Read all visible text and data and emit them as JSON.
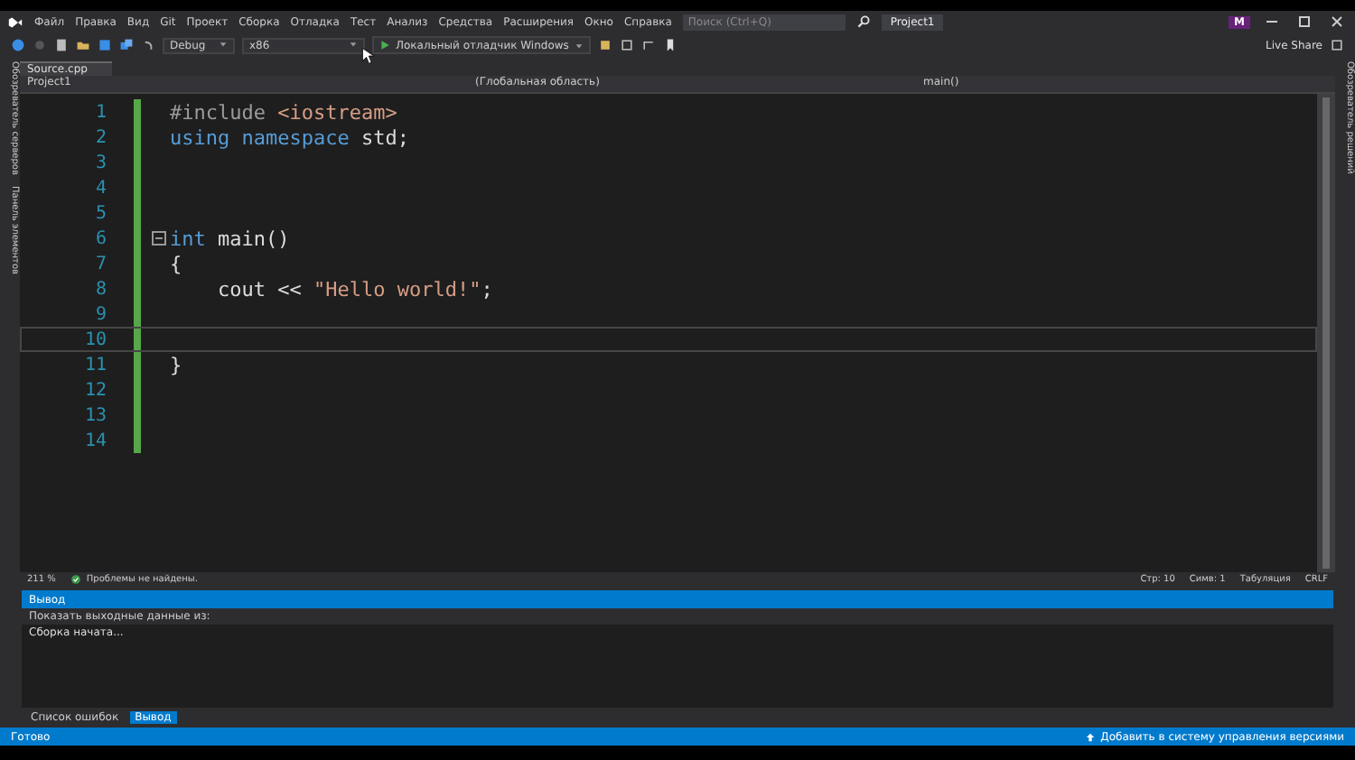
{
  "menu": [
    "Файл",
    "Правка",
    "Вид",
    "Git",
    "Проект",
    "Сборка",
    "Отладка",
    "Тест",
    "Анализ",
    "Средства",
    "Расширения",
    "Окно",
    "Справка"
  ],
  "search": {
    "placeholder": "Поиск (Ctrl+Q)"
  },
  "window": {
    "title": "Project1",
    "avatar": "M"
  },
  "toolbar": {
    "configuration": "Debug",
    "platform": "x86",
    "debugger": "Локальный отладчик Windows",
    "live_share": "Live Share"
  },
  "side_left": [
    "Обозреватель серверов",
    "Панель элементов"
  ],
  "side_right": [
    "Обозреватель решений"
  ],
  "tabs": [
    {
      "label": "Source.cpp",
      "selected": true
    }
  ],
  "nav": {
    "project": "Project1",
    "scope": "(Глобальная область)",
    "member": "main()"
  },
  "code": [
    {
      "number": "1",
      "tokens": [
        {
          "kind": "pre",
          "text": "#include"
        },
        {
          "kind": "inc",
          "text": " <iostream>"
        }
      ]
    },
    {
      "number": "2",
      "tokens": [
        {
          "kind": "keyword",
          "text": "using"
        },
        {
          "kind": "keyword",
          "text": " namespace"
        },
        {
          "kind": "plain",
          "text": " std;"
        }
      ]
    },
    {
      "number": "3"
    },
    {
      "number": "4"
    },
    {
      "number": "5"
    },
    {
      "number": "6",
      "fold": true,
      "tokens": [
        {
          "kind": "keyword",
          "text": "int"
        },
        {
          "kind": "plain",
          "text": " main()"
        }
      ]
    },
    {
      "number": "7",
      "tokens": [
        {
          "kind": "plain",
          "text": "{"
        }
      ]
    },
    {
      "number": "8",
      "tokens": [
        {
          "kind": "plain",
          "text": "    cout << "
        },
        {
          "kind": "string",
          "text": "\"Hello world!\""
        },
        {
          "kind": "plain",
          "text": ";"
        }
      ]
    },
    {
      "number": "9"
    },
    {
      "number": "10",
      "current": true
    },
    {
      "number": "11",
      "tokens": [
        {
          "kind": "plain",
          "text": "}"
        }
      ]
    },
    {
      "number": "12"
    },
    {
      "number": "13"
    },
    {
      "number": "14"
    }
  ],
  "editor_status": {
    "zoom": "211 %",
    "issues": "Проблемы не найдены.",
    "line": "Стр: 10",
    "column": "Симв: 1",
    "indent": "Табуляция",
    "eol": "CRLF"
  },
  "output": {
    "title": "Вывод",
    "source_label": "Показать выходные данные из:",
    "lines": [
      "Сборка начата..."
    ]
  },
  "bottom_tabs": [
    {
      "label": "Список ошибок",
      "selected": false
    },
    {
      "label": "Вывод",
      "selected": true
    }
  ],
  "status_bar": {
    "state": "Готово",
    "vcs": "Добавить в систему управления версиями"
  }
}
